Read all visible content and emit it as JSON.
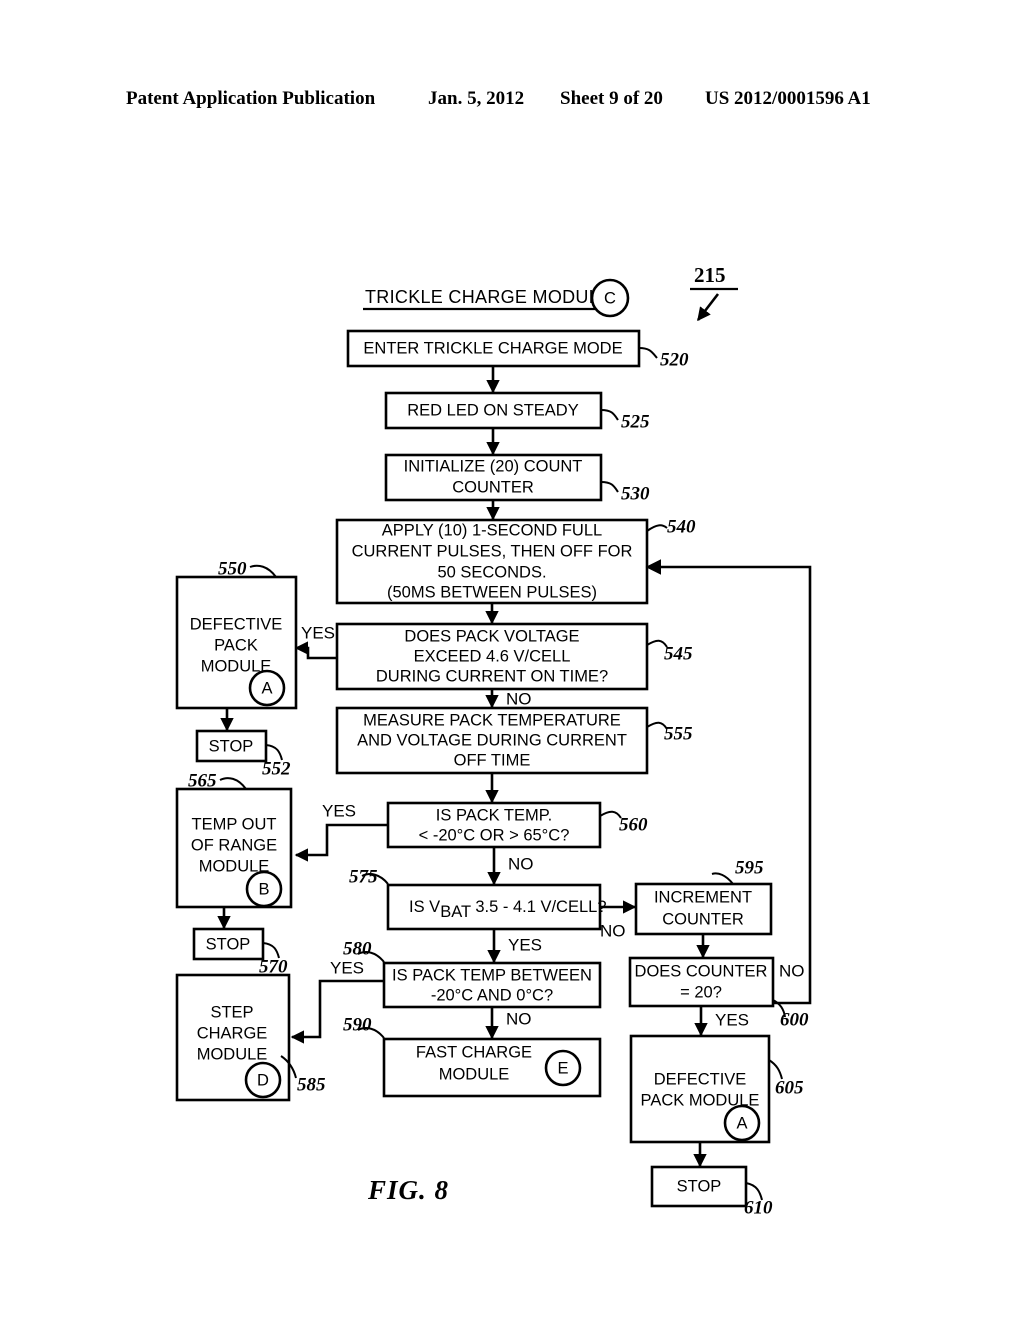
{
  "header": {
    "publication": "Patent Application Publication",
    "date": "Jan. 5, 2012",
    "sheet": "Sheet 9 of 20",
    "number": "US 2012/0001596 A1"
  },
  "figure": {
    "caption": "FIG. 8",
    "overall_ref": "215",
    "title": "TRICKLE CHARGE MODULE",
    "title_connector": "C"
  },
  "nodes": [
    {
      "id": "n520",
      "ref": "520",
      "lines": [
        "ENTER TRICKLE CHARGE MODE"
      ]
    },
    {
      "id": "n525",
      "ref": "525",
      "lines": [
        "RED LED ON STEADY"
      ]
    },
    {
      "id": "n530",
      "ref": "530",
      "lines": [
        "INITIALIZE (20) COUNT",
        "COUNTER"
      ]
    },
    {
      "id": "n540",
      "ref": "540",
      "lines": [
        "APPLY (10) 1-SECOND FULL",
        "CURRENT PULSES, THEN OFF FOR",
        "50 SECONDS.",
        "(50MS BETWEEN PULSES)"
      ]
    },
    {
      "id": "n545",
      "ref": "545",
      "lines": [
        "DOES PACK VOLTAGE",
        "EXCEED  4.6 V/CELL",
        "DURING CURRENT ON TIME?"
      ]
    },
    {
      "id": "n550",
      "ref": "550",
      "lines": [
        "DEFECTIVE",
        "PACK",
        "MODULE"
      ],
      "connector": "A"
    },
    {
      "id": "n552",
      "ref": "552",
      "lines": [
        "STOP"
      ]
    },
    {
      "id": "n555",
      "ref": "555",
      "lines": [
        "MEASURE PACK TEMPERATURE",
        "AND VOLTAGE DURING CURRENT",
        "OFF TIME"
      ]
    },
    {
      "id": "n560",
      "ref": "560",
      "lines": [
        "IS PACK TEMP.",
        "< -20°C OR > 65°C?"
      ]
    },
    {
      "id": "n565",
      "ref": "565",
      "lines": [
        "TEMP OUT",
        "OF RANGE",
        "MODULE"
      ],
      "connector": "B"
    },
    {
      "id": "n570",
      "ref": "570",
      "lines": [
        "STOP"
      ]
    },
    {
      "id": "n575",
      "ref": "575",
      "lines": [
        "IS V_BAT 3.5 - 4.1 V/CELL?"
      ],
      "text_pre": "IS V",
      "text_sub": "BAT",
      "text_post": " 3.5 - 4.1 V/CELL?"
    },
    {
      "id": "n580",
      "ref": "580",
      "lines": [
        "IS PACK TEMP BETWEEN",
        "-20°C AND 0°C?"
      ]
    },
    {
      "id": "n585",
      "ref": "585",
      "lines": [
        "STEP",
        "CHARGE",
        "MODULE"
      ],
      "connector": "D"
    },
    {
      "id": "n590",
      "ref": "590",
      "lines": [
        "FAST CHARGE",
        "MODULE"
      ],
      "connector": "E"
    },
    {
      "id": "n595",
      "ref": "595",
      "lines": [
        "INCREMENT",
        "COUNTER"
      ]
    },
    {
      "id": "n600",
      "ref": "600",
      "lines": [
        "DOES COUNTER",
        "= 20?"
      ]
    },
    {
      "id": "n605",
      "ref": "605",
      "lines": [
        "DEFECTIVE",
        "PACK MODULE"
      ],
      "connector": "A"
    },
    {
      "id": "n610",
      "ref": "610",
      "lines": [
        "STOP"
      ]
    }
  ],
  "edge_labels": {
    "yes_545": "YES",
    "no_545": "NO",
    "yes_560": "YES",
    "no_560": "NO",
    "no_575": "NO",
    "yes_575": "YES",
    "yes_580": "YES",
    "no_580": "NO",
    "no_600": "NO",
    "yes_600": "YES"
  },
  "colors": {
    "ink": "#000000",
    "paper": "#ffffff"
  }
}
